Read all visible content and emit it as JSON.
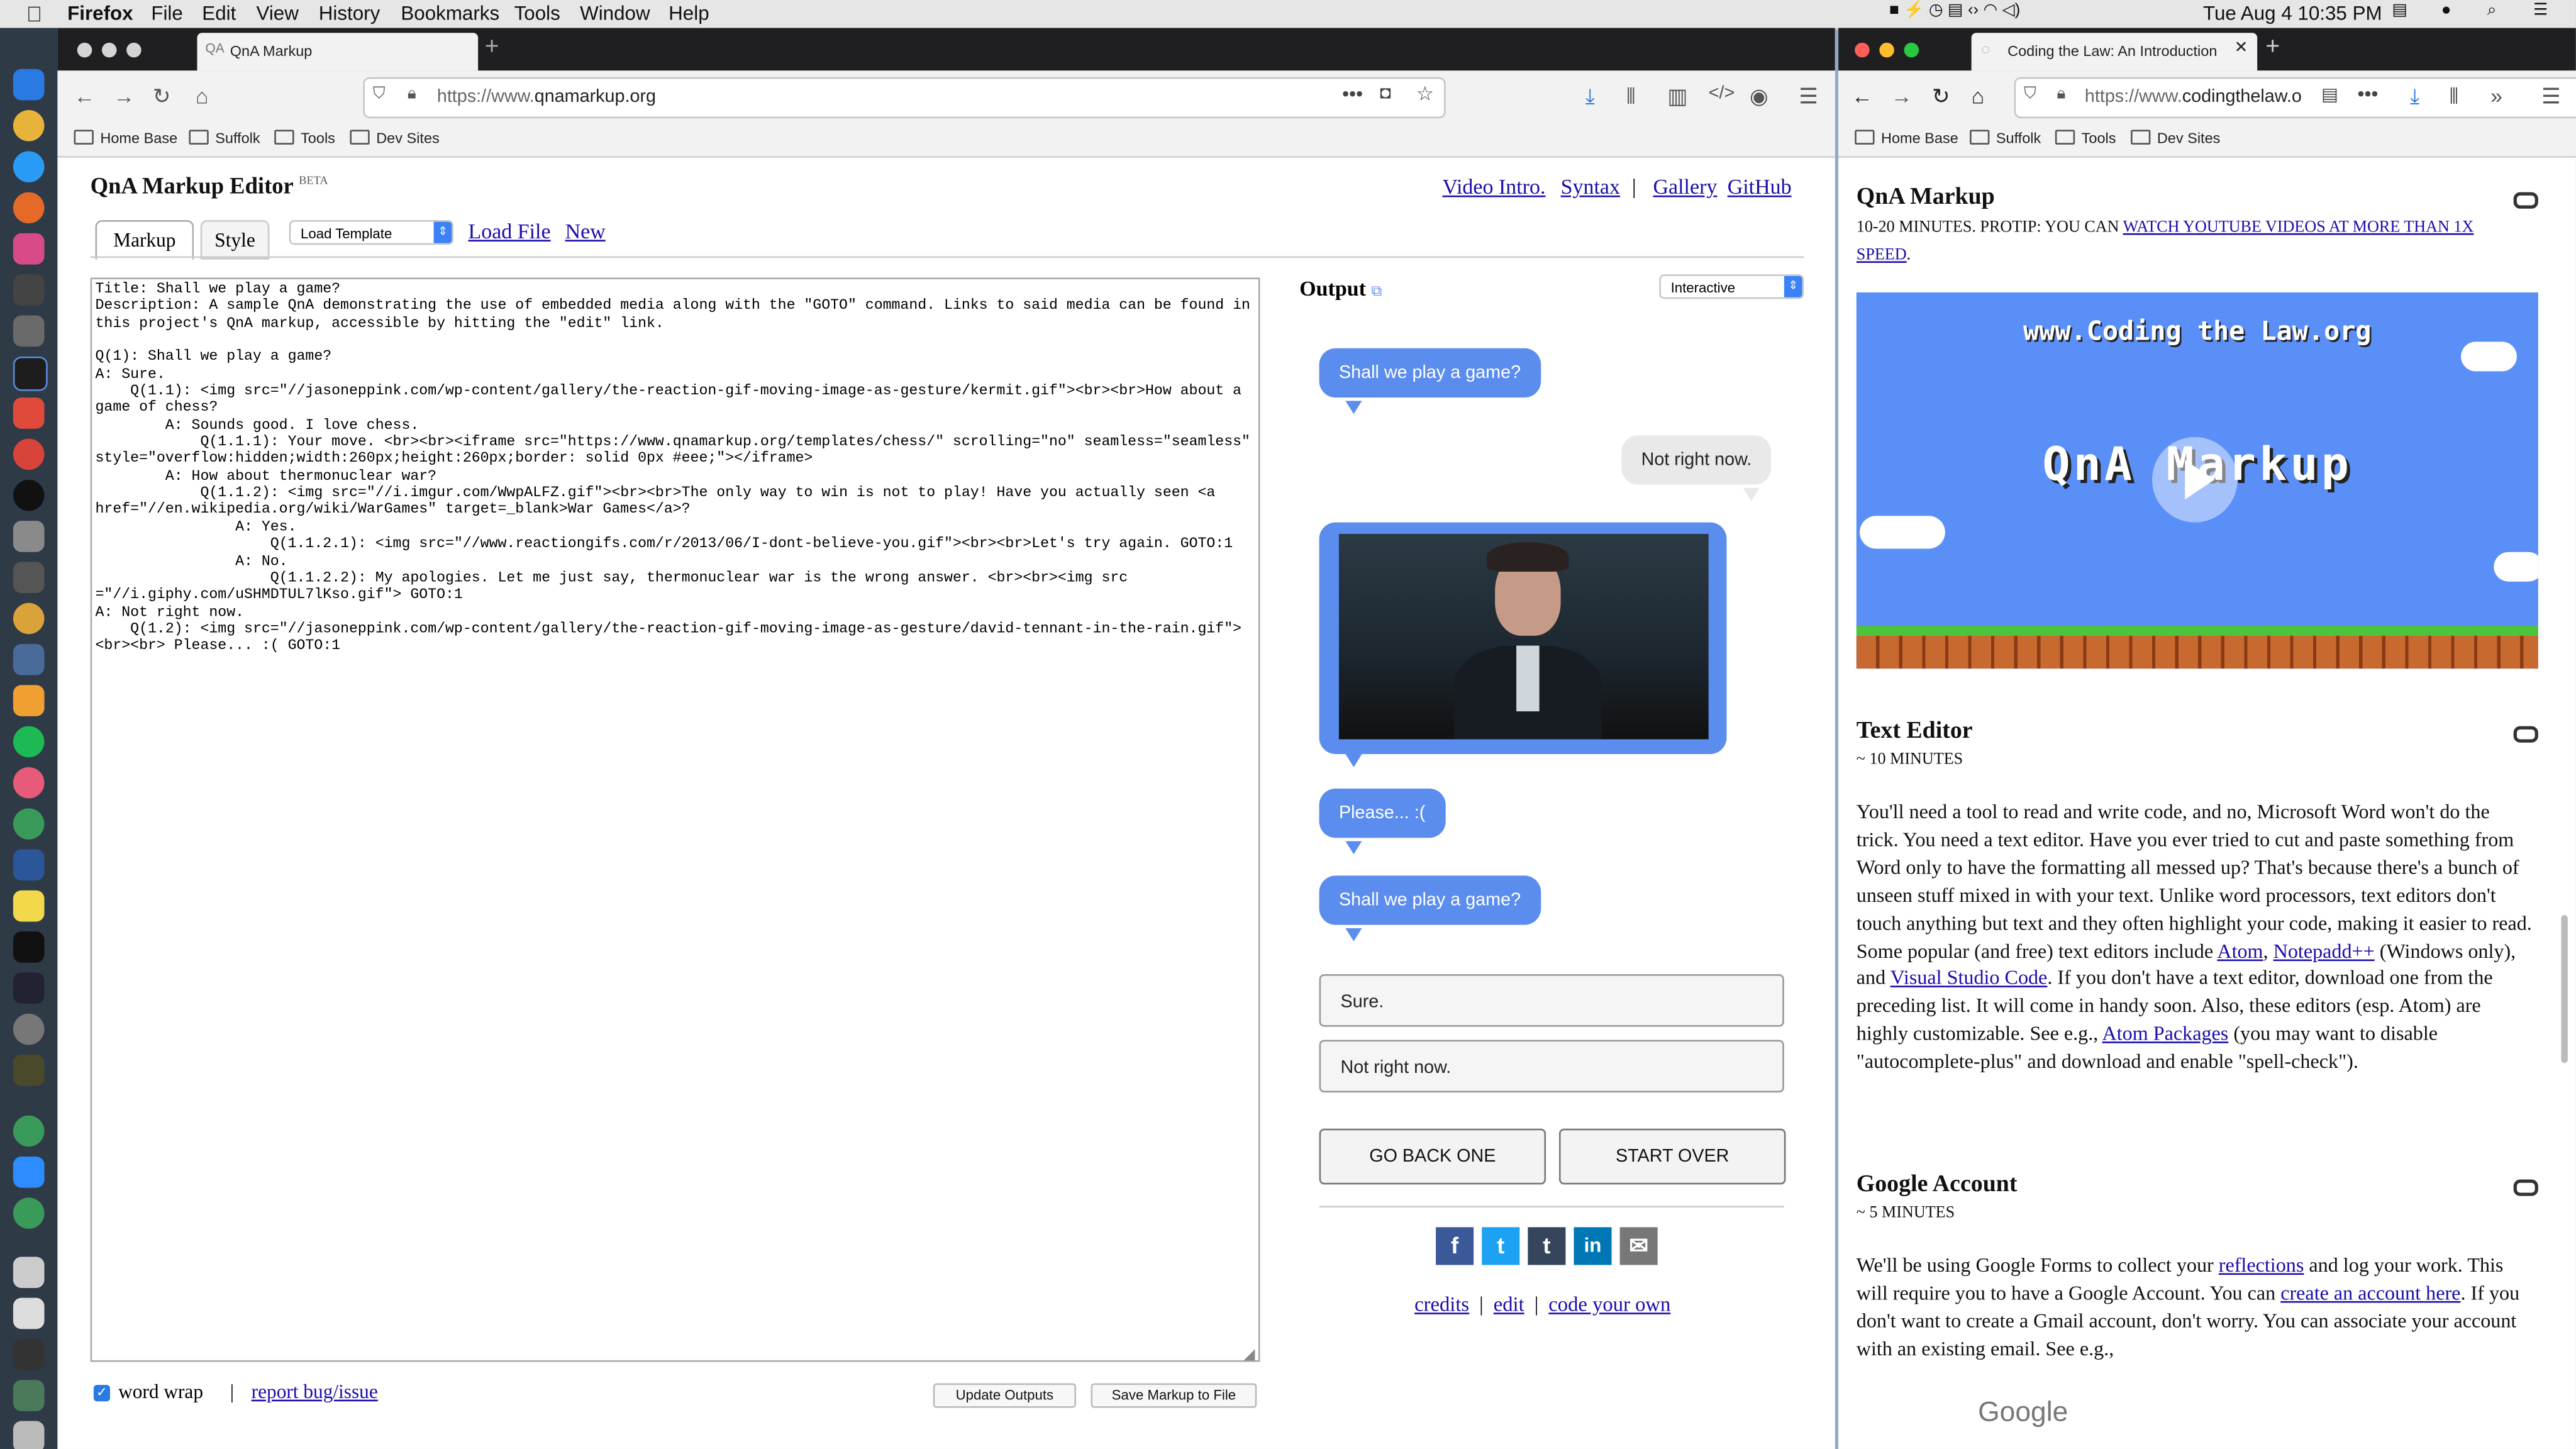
{
  "menubar": {
    "app": "Firefox",
    "items": [
      "File",
      "Edit",
      "View",
      "History",
      "Bookmarks",
      "Tools",
      "Window",
      "Help"
    ],
    "clock": "Tue Aug 4  10:35 PM"
  },
  "left_window": {
    "tab_title": "QnA Markup",
    "url_prefix": "https://www.",
    "url_domain": "qnamarkup.org",
    "bookmarks": [
      "Home Base",
      "Suffolk",
      "Tools",
      "Dev Sites"
    ],
    "page": {
      "title": "QnA Markup Editor",
      "badge": "BETA",
      "top_links": {
        "video": "Video Intro.",
        "syntax": "Syntax",
        "sep": "|",
        "gallery": "Gallery",
        "github": "GitHub"
      },
      "tabs": {
        "markup": "Markup",
        "style": "Style"
      },
      "template_select": "Load Template",
      "load_file": "Load File",
      "new": "New",
      "editor_text": "Title: Shall we play a game?\nDescription: A sample QnA demonstrating the use of embedded media along with the \"GOTO\" command. Links to said media can be found in this project's QnA markup, accessible by hitting the \"edit\" link.\n\nQ(1): Shall we play a game?\nA: Sure.\n\tQ(1.1): <img src=\"//jasoneppink.com/wp-content/gallery/the-reaction-gif-moving-image-as-gesture/kermit.gif\"><br><br>How about a game of chess?\n\t\tA: Sounds good. I love chess.\n\t\t\tQ(1.1.1): Your move. <br><br><iframe src=\"https://www.qnamarkup.org/templates/chess/\" scrolling=\"no\" seamless=\"seamless\" style=\"overflow:hidden;width:260px;height:260px;border: solid 0px #eee;\"></iframe>\n\t\tA: How about thermonuclear war?\n\t\t\tQ(1.1.2): <img src=\"//i.imgur.com/WwpALFZ.gif\"><br><br>The only way to win is not to play! Have you actually seen <a href=\"//en.wikipedia.org/wiki/WarGames\" target=_blank>War Games</a>?\n\t\t\t\tA: Yes.\n\t\t\t\t\tQ(1.1.2.1): <img src=\"//www.reactiongifs.com/r/2013/06/I-dont-believe-you.gif\"><br><br>Let's try again. GOTO:1\n\t\t\t\tA: No.\n\t\t\t\t\tQ(1.1.2.2): My apologies. Let me just say, thermonuclear war is the wrong answer. <br><br><img src =\"//i.giphy.com/uSHMDTUL7lKso.gif\"> GOTO:1\nA: Not right now.\n\tQ(1.2): <img src=\"//jasoneppink.com/wp-content/gallery/the-reaction-gif-moving-image-as-gesture/david-tennant-in-the-rain.gif\"> <br><br> Please... :( GOTO:1",
      "word_wrap": "word wrap",
      "report_bug": "report bug/issue",
      "update_outputs": "Update Outputs",
      "save_markup": "Save Markup to File",
      "output_title": "Output",
      "output_mode": "Interactive",
      "chat": {
        "q1": "Shall we play a game?",
        "a1": "Not right now.",
        "q2": "Please... :(",
        "q3": "Shall we play a game?"
      },
      "choices": [
        "Sure.",
        "Not right now."
      ],
      "go_back": "GO BACK ONE",
      "start_over": "START OVER",
      "social": [
        "f",
        "t",
        "t",
        "in",
        "✉"
      ],
      "footer_links": {
        "credits": "credits",
        "edit": "edit",
        "code": "code your own",
        "sep": "|"
      }
    }
  },
  "right_window": {
    "tab_title": "Coding the Law: An Introduction",
    "url_prefix": "https://www.",
    "url_domain": "codingthelaw.o",
    "bookmarks": [
      "Home Base",
      "Suffolk",
      "Tools",
      "Dev Sites"
    ],
    "sections": {
      "qna": {
        "heading": "QnA Markup",
        "subline_plain": "10-20 MINUTES. PROTIP: YOU CAN ",
        "subline_link": "WATCH YOUTUBE VIDEOS AT MORE THAN 1X SPEED",
        "subline_end": ".",
        "video_site": "www.Coding the Law.org",
        "video_title": "QnA Markup"
      },
      "text_editor": {
        "heading": "Text Editor",
        "time": "~ 10 MINUTES",
        "p1": "You'll need a tool to read and write code, and no, Microsoft Word won't do the trick. You need a text editor. Have you ever tried to cut and paste something from Word only to have the formatting all messed up? That's because there's a bunch of unseen stuff mixed in with your text. Unlike word processors, text editors don't touch anything but text and they often highlight your code, making it easier to read. Some popular (and free) text editors include ",
        "link_atom": "Atom",
        "comma1": ", ",
        "link_notepad": "Notepadd++",
        "p2": " (Windows only), and ",
        "link_vscode": "Visual Studio Code",
        "p3": ". If you don't have a text editor, download one from the preceding list. It will come in handy soon. Also, these editors (esp. Atom) are highly customizable. See e.g., ",
        "link_packages": "Atom Packages",
        "p4": " (you may want to disable \"autocomplete-plus\" and download and enable \"spell-check\")."
      },
      "google": {
        "heading": "Google Account",
        "time": "~ 5 MINUTES",
        "p1": "We'll be using Google Forms to collect your ",
        "link_reflections": "reflections",
        "p2": " and log your work. This will require you to have a Google Account. You can ",
        "link_create": "create an account here",
        "p3": ". If you don't want to create a Gmail account, don't worry. You can associate your account with an existing email. See e.g.,",
        "logo": "Google"
      }
    }
  },
  "colors": {
    "bubble_blue": "#5b8def",
    "bubble_grey": "#e9e9e9",
    "link": "#1a0dab",
    "dock": "#2f3a47"
  }
}
